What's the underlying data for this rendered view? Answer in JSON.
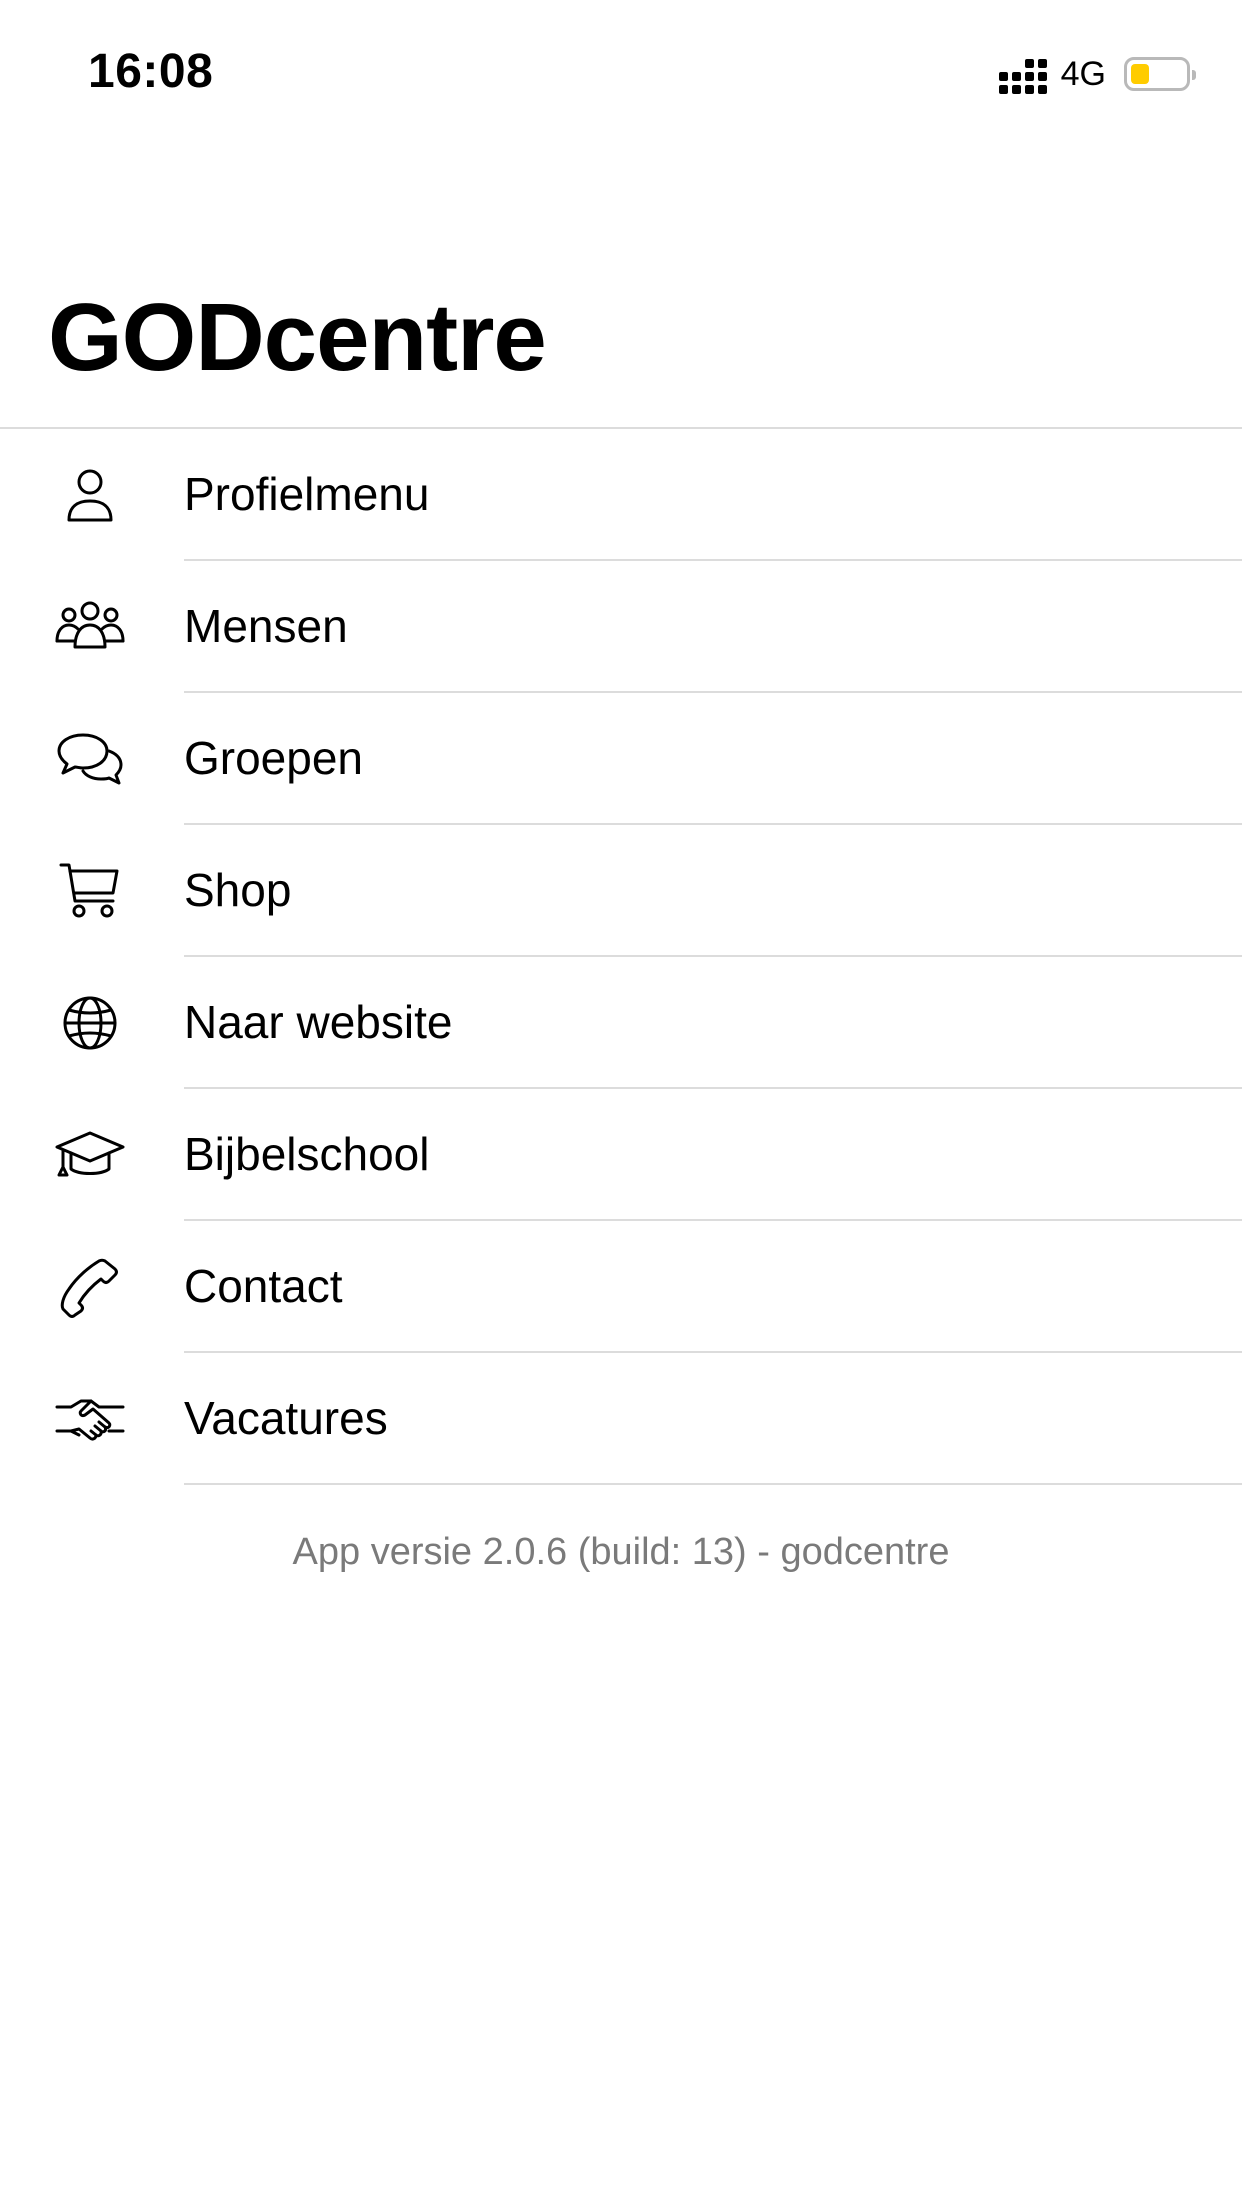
{
  "status_bar": {
    "time": "16:08",
    "network": "4G",
    "battery_level": 0.35,
    "battery_color": "#ffcc00"
  },
  "header": {
    "title": "GODcentre"
  },
  "menu": {
    "items": [
      {
        "label": "Profielmenu",
        "icon": "person-icon"
      },
      {
        "label": "Mensen",
        "icon": "people-icon"
      },
      {
        "label": "Groepen",
        "icon": "chat-bubbles-icon"
      },
      {
        "label": "Shop",
        "icon": "cart-icon"
      },
      {
        "label": "Naar website",
        "icon": "globe-icon"
      },
      {
        "label": "Bijbelschool",
        "icon": "graduation-cap-icon"
      },
      {
        "label": "Contact",
        "icon": "phone-icon"
      },
      {
        "label": "Vacatures",
        "icon": "handshake-icon"
      }
    ]
  },
  "footer": {
    "version_text": "App versie 2.0.6 (build: 13) - godcentre"
  },
  "colors": {
    "separator": "#dcdcdc",
    "secondary_text": "#7a7a7a"
  }
}
